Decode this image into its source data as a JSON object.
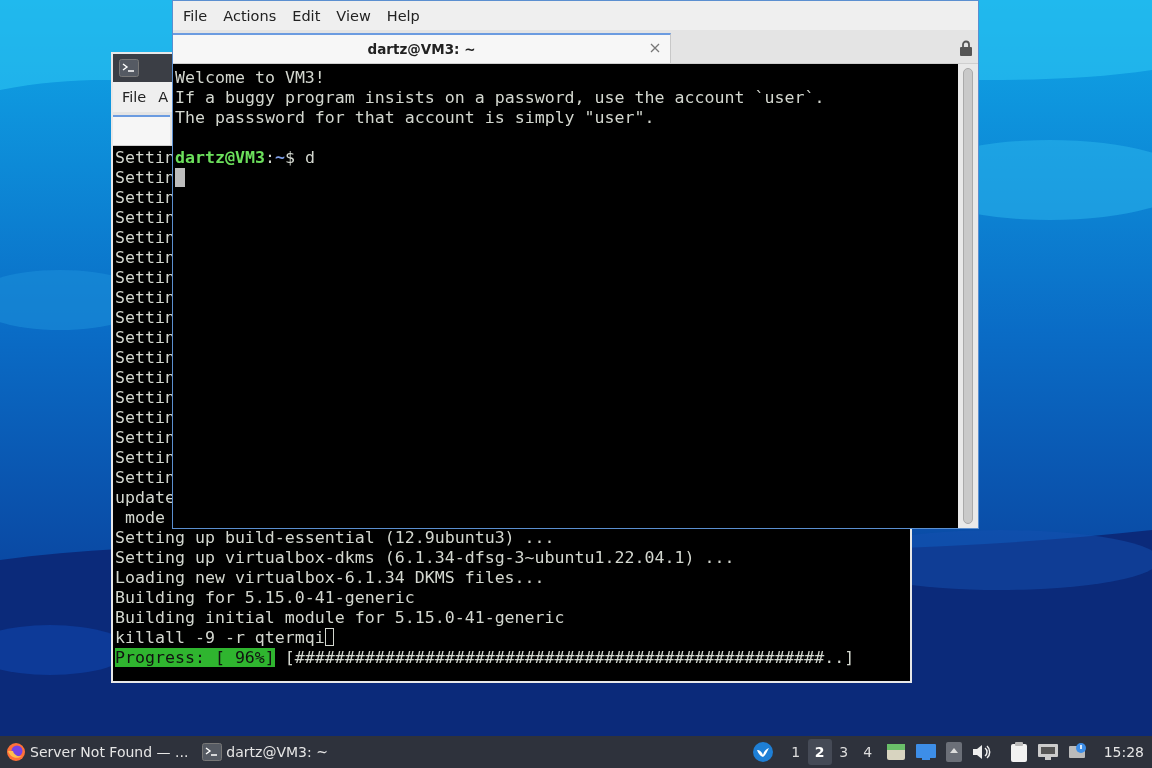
{
  "back_terminal": {
    "menu": [
      "File",
      "A"
    ],
    "lines": [
      "Settin",
      "Settin",
      "Settin",
      "Settin",
      "Settin",
      "Settin",
      "Settin",
      "Settin",
      "Settin",
      "Settin",
      "Settin",
      "Settin",
      "Settin",
      "Settin",
      "Settin",
      "Settin",
      "Settin",
      "update",
      " mode",
      "Setting up build-essential (12.9ubuntu3) ...",
      "Setting up virtualbox-dkms (6.1.34-dfsg-3~ubuntu1.22.04.1) ...",
      "Loading new virtualbox-6.1.34 DKMS files...",
      "Building for 5.15.0-41-generic",
      "Building initial module for 5.15.0-41-generic"
    ],
    "command_line": "killall -9 -r qtermqi",
    "progress": {
      "label": "Progress: [ 96%]",
      "bar": "[#####################################################..]"
    }
  },
  "front_terminal": {
    "menu": [
      "File",
      "Actions",
      "Edit",
      "View",
      "Help"
    ],
    "tabs": [
      {
        "title": "dartz@VM3: ~",
        "selected": true
      }
    ],
    "lines": [
      "Welcome to VM3!",
      "If a buggy program insists on a password, use the account `user`.",
      "The passsword for that account is simply \"user\"."
    ],
    "prompt": {
      "user_host": "dartz@VM3",
      "separator": ":",
      "path": "~",
      "symbol": "$",
      "command": "d"
    }
  },
  "taskbar": {
    "tasks": [
      {
        "kind": "browser",
        "label": "Server Not Found — ..."
      },
      {
        "kind": "terminal",
        "label": "dartz@VM3: ~"
      }
    ],
    "workspaces": [
      {
        "label": "1",
        "selected": false
      },
      {
        "label": "2",
        "selected": true
      },
      {
        "label": "3",
        "selected": false
      },
      {
        "label": "4",
        "selected": false
      }
    ],
    "clock": "15:28"
  }
}
